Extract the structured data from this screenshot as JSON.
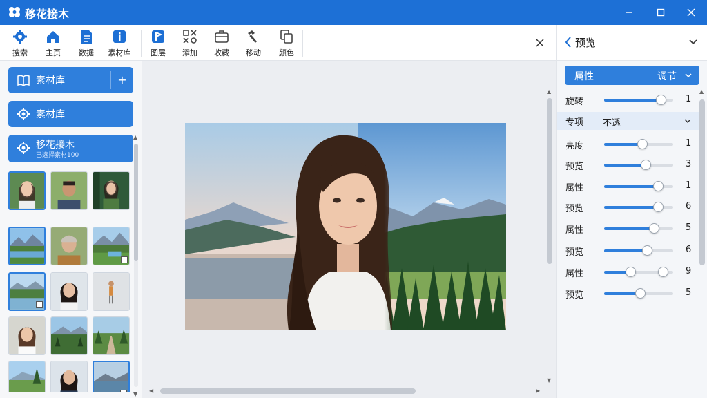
{
  "app": {
    "title": "移花接木"
  },
  "toolbar": {
    "items": [
      {
        "label": "搜索",
        "icon": "gear-icon"
      },
      {
        "label": "主页",
        "icon": "home-icon"
      },
      {
        "label": "数据",
        "icon": "document-icon"
      },
      {
        "label": "素材库",
        "icon": "info-icon"
      },
      {
        "label": "图层",
        "icon": "flag-icon"
      },
      {
        "label": "添加",
        "icon": "transform-icon"
      },
      {
        "label": "收藏",
        "icon": "briefcase-icon"
      },
      {
        "label": "移动",
        "icon": "hammer-icon"
      },
      {
        "label": "颜色",
        "icon": "copy-icon"
      }
    ]
  },
  "left_panel": {
    "buttons": [
      {
        "label": "素材库",
        "icon": "book-icon",
        "action": "+"
      },
      {
        "label": "素材库",
        "icon": "gear-icon"
      },
      {
        "label": "移花接木",
        "sub": "已选择素材100",
        "icon": "gear-icon"
      }
    ]
  },
  "right_panel": {
    "header": "预览",
    "tab_left": "属性",
    "tab_right": "调节",
    "properties": [
      {
        "name": "旋转",
        "value": "1",
        "fill": 0.82
      },
      {
        "name": "专项",
        "select_value": "不透",
        "is_select": true
      },
      {
        "name": "亮度",
        "value": "1",
        "fill": 0.55
      },
      {
        "name": "预览",
        "value": "3",
        "fill": 0.6
      },
      {
        "name": "属性",
        "value": "1",
        "fill": 0.78
      },
      {
        "name": "预览",
        "value": "6",
        "fill": 0.78
      },
      {
        "name": "属性",
        "value": "5",
        "fill": 0.72
      },
      {
        "name": "预览",
        "value": "6",
        "fill": 0.62
      },
      {
        "name": "属性",
        "value": "9",
        "fill": 0.38,
        "fill2": 0.85,
        "range": true
      },
      {
        "name": "预览",
        "value": "5",
        "fill": 0.52
      }
    ]
  },
  "colors": {
    "accent": "#2f7fdc",
    "titlebar": "#1d70d6"
  }
}
